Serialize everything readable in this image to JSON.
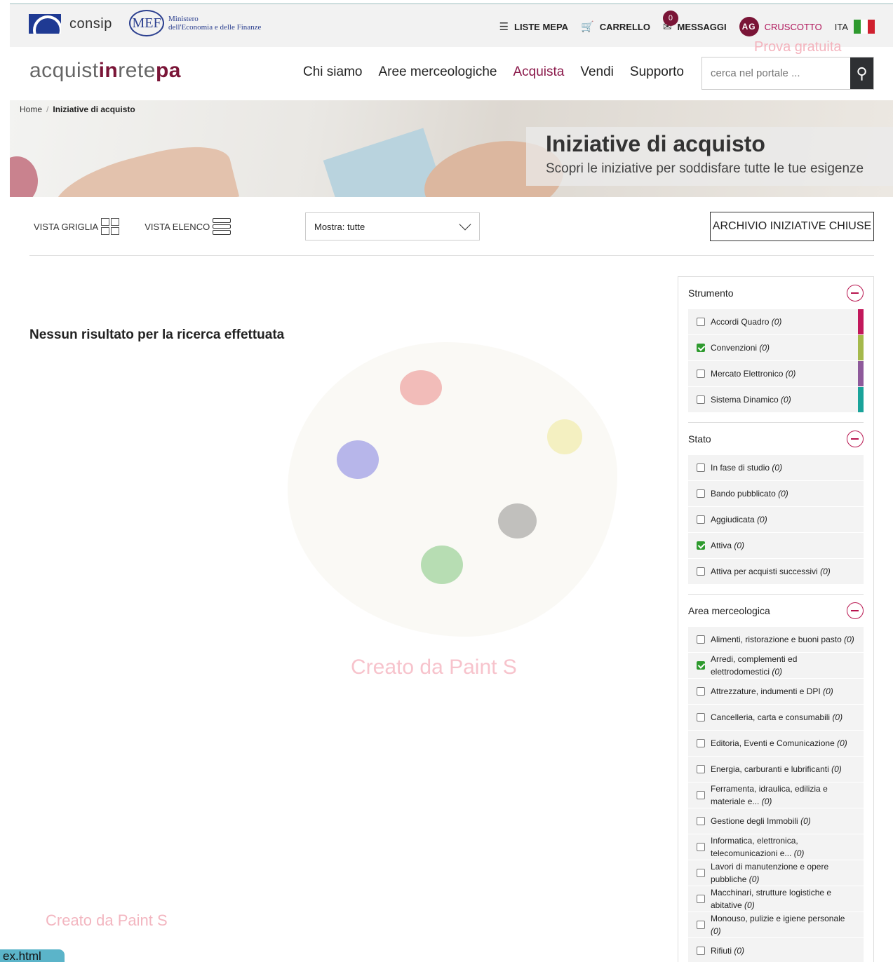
{
  "topbar": {
    "consip": "consip",
    "mef_badge": "MEF",
    "mef_line1": "Ministero",
    "mef_line2": "dell'Economia e delle Finanze",
    "liste": "LISTE MEPA",
    "carrello": "CARRELLO",
    "messaggi": "MESSAGGI",
    "messaggi_count": "0",
    "avatar": "AG",
    "cruscotto": "CRUSCOTTO",
    "lang": "ITA",
    "prova": "Prova gratuita"
  },
  "header": {
    "brand_a": "acquist",
    "brand_b": "in",
    "brand_c": "rete",
    "brand_d": "pa",
    "nav": [
      "Chi siamo",
      "Aree merceologiche",
      "Acquista",
      "Vendi",
      "Supporto"
    ],
    "search_placeholder": "cerca nel portale ..."
  },
  "hero": {
    "crumb_home": "Home",
    "crumb_current": "Iniziative di acquisto",
    "title": "Iniziative di acquisto",
    "subtitle": "Scopri le iniziative per soddisfare tutte le tue esigenze"
  },
  "toolbar": {
    "grid_view": "VISTA GRIGLIA",
    "list_view": "VISTA ELENCO",
    "select_value": "Mostra: tutte",
    "archive": "ARCHIVIO INIZIATIVE CHIUSE"
  },
  "main": {
    "no_result": "Nessun risultato per la ricerca effettuata",
    "watermark": "Creato da Paint S"
  },
  "filters": {
    "strumento": {
      "title": "Strumento",
      "items": [
        {
          "label": "Accordi Quadro",
          "count": "(0)",
          "checked": false,
          "color": "#c2185b"
        },
        {
          "label": "Convenzioni",
          "count": "(0)",
          "checked": true,
          "color": "#a5b94c"
        },
        {
          "label": "Mercato Elettronico",
          "count": "(0)",
          "checked": false,
          "color": "#8e5a9b"
        },
        {
          "label": "Sistema Dinamico",
          "count": "(0)",
          "checked": false,
          "color": "#1aa39a"
        }
      ]
    },
    "stato": {
      "title": "Stato",
      "items": [
        {
          "label": "In fase di studio",
          "count": "(0)",
          "checked": false
        },
        {
          "label": "Bando pubblicato",
          "count": "(0)",
          "checked": false
        },
        {
          "label": "Aggiudicata",
          "count": "(0)",
          "checked": false
        },
        {
          "label": "Attiva",
          "count": "(0)",
          "checked": true
        },
        {
          "label": "Attiva per acquisti successivi",
          "count": "(0)",
          "checked": false
        }
      ]
    },
    "area": {
      "title": "Area merceologica",
      "items": [
        {
          "label": "Alimenti, ristorazione e buoni pasto",
          "count": "(0)",
          "checked": false
        },
        {
          "label": "Arredi, complementi ed elettrodomestici",
          "count": "(0)",
          "checked": true
        },
        {
          "label": "Attrezzature, indumenti e DPI",
          "count": "(0)",
          "checked": false
        },
        {
          "label": "Cancelleria, carta e consumabili",
          "count": "(0)",
          "checked": false
        },
        {
          "label": "Editoria, Eventi e Comunicazione",
          "count": "(0)",
          "checked": false
        },
        {
          "label": "Energia, carburanti e lubrificanti",
          "count": "(0)",
          "checked": false
        },
        {
          "label": "Ferramenta, idraulica, edilizia e materiale e...",
          "count": "(0)",
          "checked": false
        },
        {
          "label": "Gestione degli Immobili",
          "count": "(0)",
          "checked": false
        },
        {
          "label": "Informatica, elettronica, telecomunicazioni e...",
          "count": "(0)",
          "checked": false
        },
        {
          "label": "Lavori di manutenzione e opere pubbliche",
          "count": "(0)",
          "checked": false
        },
        {
          "label": "Macchinari, strutture logistiche e abitative",
          "count": "(0)",
          "checked": false
        },
        {
          "label": "Monouso, pulizie e igiene personale",
          "count": "(0)",
          "checked": false
        },
        {
          "label": "Rifiuti",
          "count": "(0)",
          "checked": false
        }
      ]
    }
  },
  "bottom_tab": "ex.html"
}
